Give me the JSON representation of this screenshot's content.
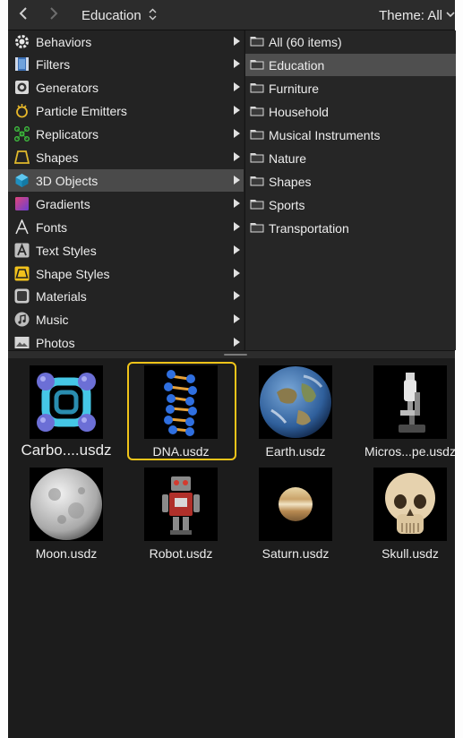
{
  "toolbar": {
    "back_icon": "chevron-left-icon",
    "forward_icon": "chevron-right-icon",
    "title": "Education",
    "title_indicator": "⌃⌄",
    "theme_label": "Theme: All",
    "theme_indicator": "⌄"
  },
  "categories": [
    {
      "label": "Behaviors",
      "icon": "gear-icon"
    },
    {
      "label": "Filters",
      "icon": "film-icon"
    },
    {
      "label": "Generators",
      "icon": "generator-icon"
    },
    {
      "label": "Particle Emitters",
      "icon": "emitter-icon"
    },
    {
      "label": "Replicators",
      "icon": "replicator-icon"
    },
    {
      "label": "Shapes",
      "icon": "shape-icon"
    },
    {
      "label": "3D Objects",
      "icon": "cube-icon",
      "selected": true
    },
    {
      "label": "Gradients",
      "icon": "gradient-icon"
    },
    {
      "label": "Fonts",
      "icon": "font-icon"
    },
    {
      "label": "Text Styles",
      "icon": "text-style-icon"
    },
    {
      "label": "Shape Styles",
      "icon": "shape-style-icon"
    },
    {
      "label": "Materials",
      "icon": "material-icon"
    },
    {
      "label": "Music",
      "icon": "music-icon"
    },
    {
      "label": "Photos",
      "icon": "photo-icon"
    }
  ],
  "folders": [
    {
      "label": "All (60 items)"
    },
    {
      "label": "Education",
      "selected": true
    },
    {
      "label": "Furniture"
    },
    {
      "label": "Household"
    },
    {
      "label": "Musical Instruments"
    },
    {
      "label": "Nature"
    },
    {
      "label": "Shapes"
    },
    {
      "label": "Sports"
    },
    {
      "label": "Transportation"
    }
  ],
  "items": [
    {
      "label": "Carbo....usdz",
      "icon": "carbon-molecule-icon"
    },
    {
      "label": "DNA.usdz",
      "icon": "dna-icon",
      "selected": true
    },
    {
      "label": "Earth.usdz",
      "icon": "earth-icon"
    },
    {
      "label": "Micros...pe.usdz",
      "icon": "microscope-icon"
    },
    {
      "label": "Moon.usdz",
      "icon": "moon-icon"
    },
    {
      "label": "Robot.usdz",
      "icon": "robot-icon"
    },
    {
      "label": "Saturn.usdz",
      "icon": "saturn-icon"
    },
    {
      "label": "Skull.usdz",
      "icon": "skull-icon"
    }
  ],
  "colors": {
    "selection_highlight": "#f0c419",
    "selected_row": "#4a4a4a",
    "background": "#1e1e1e"
  }
}
